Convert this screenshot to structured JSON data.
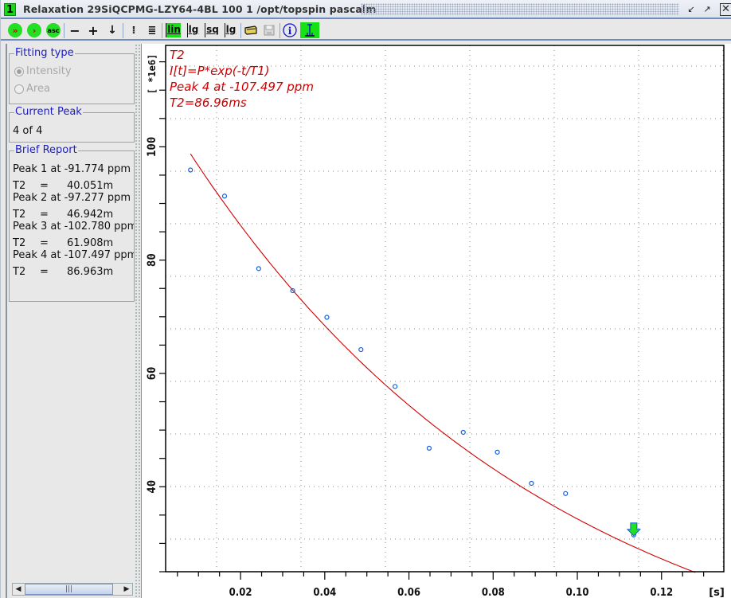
{
  "window": {
    "number": "1",
    "title": "Relaxation 29SiQCPMG-LZY64-4BL  100  1  /opt/topspin  pascalm",
    "buttons": {
      "minimize": "minimize-icon",
      "maximize": "maximize-icon",
      "close": "close-icon"
    }
  },
  "toolbar": {
    "buttons": [
      {
        "name": "fit-all-peaks",
        "label": "»",
        "icon": "double-arrow-icon"
      },
      {
        "name": "fit-peak",
        "label": "›",
        "icon": "arrow-icon"
      },
      {
        "name": "ascii",
        "label": "asc",
        "icon": "asc-icon"
      },
      {
        "name": "decrease",
        "label": "−",
        "icon": "minus-icon"
      },
      {
        "name": "increase",
        "label": "+",
        "icon": "plus-icon"
      },
      {
        "name": "next",
        "label": "↓",
        "icon": "down-arrow-icon"
      },
      {
        "name": "show-points",
        "label": "⁞",
        "icon": "dotted-list-icon"
      },
      {
        "name": "show-list",
        "label": "≣",
        "icon": "list-icon"
      },
      {
        "name": "scale-lin",
        "label": "lin",
        "active": true
      },
      {
        "name": "scale-lg",
        "label": "lg",
        "active": false
      },
      {
        "name": "scale-sq",
        "label": "sq",
        "active": false
      },
      {
        "name": "scale-lglg",
        "label": "lg",
        "active": false
      },
      {
        "name": "export",
        "label": "",
        "icon": "folder-icon"
      },
      {
        "name": "save",
        "label": "",
        "icon": "save-icon"
      },
      {
        "name": "info",
        "label": "i",
        "icon": "info-icon"
      },
      {
        "name": "peak-marker",
        "label": "I",
        "icon": "peak-icon",
        "active": true
      }
    ]
  },
  "sidebar": {
    "fitting_type": {
      "title": "Fitting type",
      "options": [
        {
          "label": "Intensity",
          "selected": true,
          "enabled": false
        },
        {
          "label": "Area",
          "selected": false,
          "enabled": false
        }
      ]
    },
    "current_peak": {
      "title": "Current Peak",
      "value": "4 of 4"
    },
    "brief_report": {
      "title": "Brief Report",
      "entries": [
        {
          "peak": "Peak 1 at -91.774 ppm",
          "t2_label": "T2",
          "eq": "=",
          "t2": "40.051m"
        },
        {
          "peak": "Peak 2 at -97.277 ppm",
          "t2_label": "T2",
          "eq": "=",
          "t2": "46.942m"
        },
        {
          "peak": "Peak 3 at -102.780 ppm",
          "t2_label": "T2",
          "eq": "=",
          "t2": "61.908m"
        },
        {
          "peak": "Peak 4 at -107.497 ppm",
          "t2_label": "T2",
          "eq": "=",
          "t2": "86.963m"
        }
      ]
    }
  },
  "chart_data": {
    "type": "scatter",
    "title": "T2",
    "annotations": [
      "T2",
      "I[t]=P*exp(-t/T1)",
      "Peak 4 at -107.497 ppm",
      "T2=86.96ms"
    ],
    "xlabel": "[s]",
    "ylabel": "[ *1e6]",
    "xlim": [
      0.0022,
      0.1348
    ],
    "ylim": [
      25.0,
      117.9
    ],
    "xticks": [
      0.02,
      0.04,
      0.06,
      0.08,
      0.1,
      0.12
    ],
    "xtick_labels": [
      "0.02",
      "0.04",
      "0.06",
      "0.08",
      "0.10",
      "0.12"
    ],
    "yticks": [
      40,
      60,
      80,
      100
    ],
    "ytick_labels": [
      "40",
      "60",
      "80",
      "100"
    ],
    "grid": true,
    "series": [
      {
        "name": "measured",
        "kind": "points",
        "color": "#1060e0",
        "x": [
          0.0081,
          0.0162,
          0.0243,
          0.0324,
          0.0405,
          0.0486,
          0.0567,
          0.0648,
          0.0729,
          0.081,
          0.0891,
          0.0972,
          0.1134
        ],
        "y": [
          95.9,
          91.3,
          78.5,
          74.6,
          69.9,
          64.2,
          57.7,
          46.8,
          49.6,
          46.1,
          40.6,
          38.8,
          31.5
        ]
      },
      {
        "name": "fit",
        "kind": "curve",
        "color": "#d00000",
        "model": "P*exp(-t/T2)",
        "P": 108.4,
        "T2": 0.08696,
        "x_range": [
          0.0081,
          0.128
        ]
      }
    ],
    "marker": {
      "x": 0.1134,
      "y": 31.5,
      "color": "#22e022",
      "icon": "green-down-arrow"
    }
  },
  "colors": {
    "accent": "#6f8bbf",
    "group_title": "#1c1cc8",
    "annotation": "#d00000",
    "active_button": "#16e016"
  }
}
